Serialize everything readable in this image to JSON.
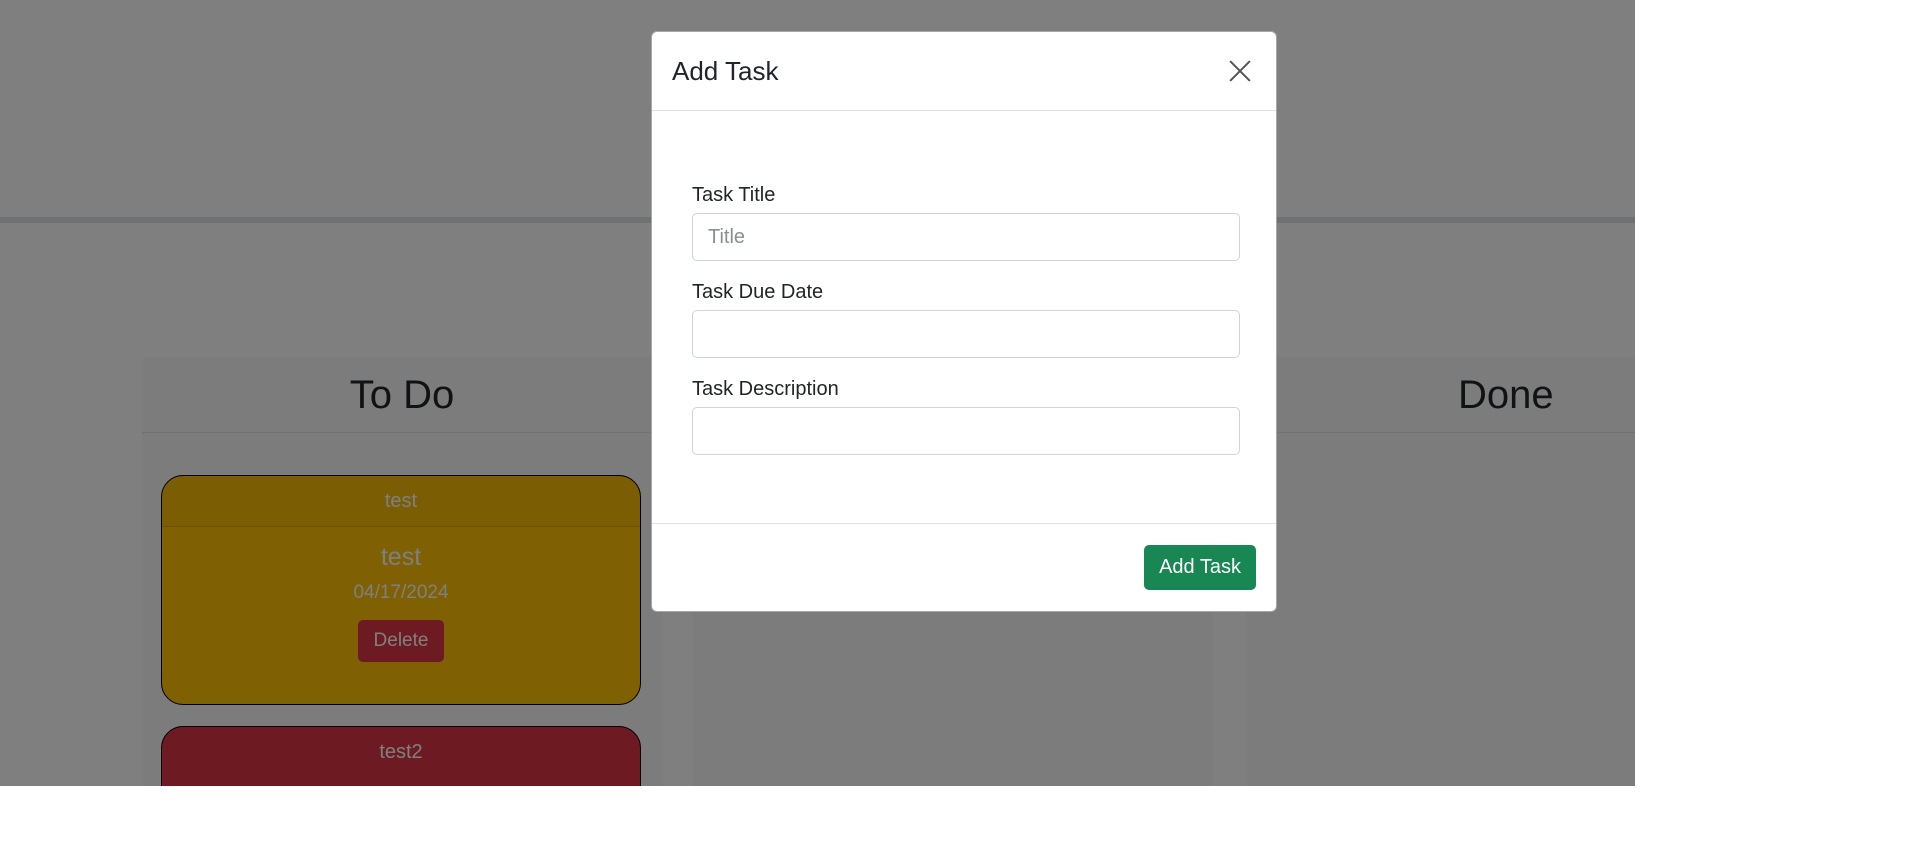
{
  "board": {
    "lanes": [
      {
        "title": "To Do"
      },
      {
        "title": ""
      },
      {
        "title": "Done"
      }
    ],
    "cards": [
      {
        "header": "test",
        "title": "test",
        "date": "04/17/2024",
        "delete_label": "Delete",
        "color": "#ffc107"
      },
      {
        "header": "test2",
        "color": "#dc3545"
      }
    ]
  },
  "modal": {
    "title": "Add Task",
    "close_icon": "close-icon",
    "fields": {
      "title": {
        "label": "Task Title",
        "placeholder": "Title",
        "value": ""
      },
      "due_date": {
        "label": "Task Due Date",
        "value": ""
      },
      "description": {
        "label": "Task Description",
        "value": ""
      }
    },
    "submit_label": "Add Task"
  },
  "colors": {
    "backdrop": "#808080",
    "submit": "#198754",
    "card_warning": "#ffc107",
    "card_danger": "#dc3545"
  }
}
